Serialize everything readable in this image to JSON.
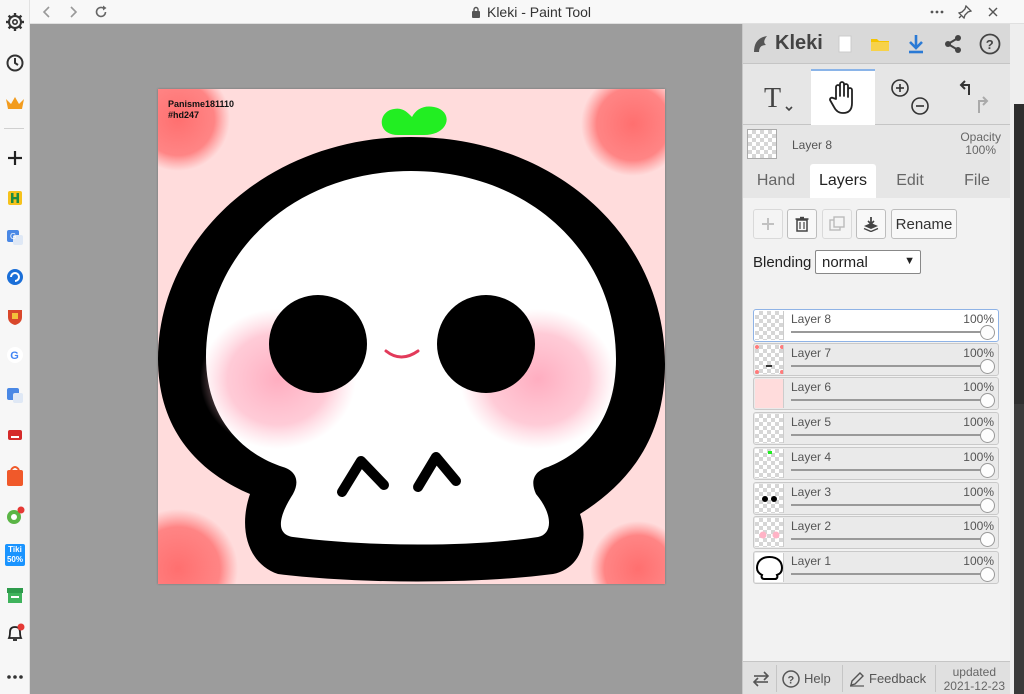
{
  "window": {
    "title": "Kleki - Paint Tool"
  },
  "canvas": {
    "signature_line1": "Panisme181110",
    "signature_line2": "#hd247"
  },
  "panel": {
    "brand": "Kleki",
    "current_layer": "Layer 8",
    "opacity_label": "Opacity",
    "opacity_value": "100%",
    "tabs": [
      {
        "label": "Hand",
        "active": false
      },
      {
        "label": "Layers",
        "active": true
      },
      {
        "label": "Edit",
        "active": false
      },
      {
        "label": "File",
        "active": false
      }
    ],
    "rename_label": "Rename",
    "blending_label": "Blending",
    "blending_value": "normal",
    "layers": [
      {
        "name": "Layer 8",
        "opacity": "100%",
        "active": true
      },
      {
        "name": "Layer 7",
        "opacity": "100%",
        "active": false
      },
      {
        "name": "Layer 6",
        "opacity": "100%",
        "active": false
      },
      {
        "name": "Layer 5",
        "opacity": "100%",
        "active": false
      },
      {
        "name": "Layer 4",
        "opacity": "100%",
        "active": false
      },
      {
        "name": "Layer 3",
        "opacity": "100%",
        "active": false
      },
      {
        "name": "Layer 2",
        "opacity": "100%",
        "active": false
      },
      {
        "name": "Layer 1",
        "opacity": "100%",
        "active": false
      }
    ],
    "footer": {
      "help": "Help",
      "feedback": "Feedback",
      "updated_label": "updated",
      "updated_date": "2021-12-23"
    }
  },
  "sidebar_icons": [
    "gear-icon",
    "history-icon",
    "crown-icon",
    "add-icon",
    "h-app-icon",
    "translate-icon",
    "refresh-app-icon",
    "shield-app-icon",
    "google-icon",
    "translate-icon-2",
    "red-app-icon",
    "shopee-icon",
    "green-app-icon",
    "tiki-icon",
    "store-icon",
    "bell-icon",
    "more-icon"
  ],
  "sidebar_texts": {
    "tiki": "Tiki",
    "tiki_badge": "50%"
  },
  "colors": {
    "canvas_bg": "#ffdcdc",
    "active_tab": "#ffffff",
    "accent": "#8fb3e6",
    "download": "#2a7ad5",
    "folder": "#f5c400"
  }
}
